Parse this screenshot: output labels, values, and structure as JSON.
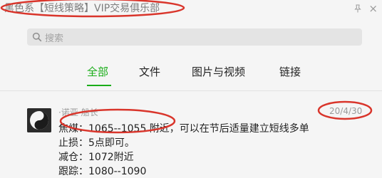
{
  "window": {
    "title": "黑色系【短线策略】VIP交易俱乐部",
    "close": "×"
  },
  "search": {
    "placeholder": "搜索"
  },
  "tabs": [
    {
      "label": "全部",
      "active": true
    },
    {
      "label": "文件",
      "active": false
    },
    {
      "label": "图片与视频",
      "active": false
    },
    {
      "label": "链接",
      "active": false
    }
  ],
  "message": {
    "sender": "·诺亚·船长",
    "date": "20/4/30",
    "lines": [
      "焦煤：1065--1055 附近，可以在节后适量建立短线多单",
      "止损：5点即可。",
      "减仓：1072附近",
      "跟踪：1080--1090"
    ]
  },
  "colors": {
    "accent": "#1aad19",
    "annotation": "#d9352b"
  }
}
